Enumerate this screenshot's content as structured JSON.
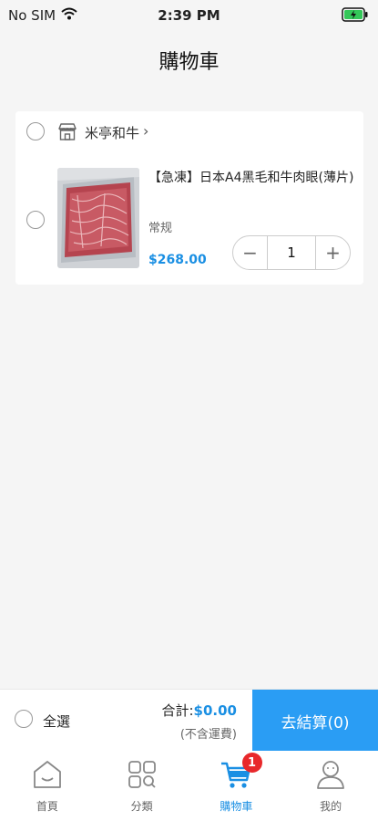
{
  "status_bar": {
    "carrier": "No SIM",
    "time": "2:39 PM"
  },
  "nav": {
    "title": "購物車"
  },
  "shop": {
    "name": "米亭和牛",
    "chevron": "›"
  },
  "item": {
    "title": "【急凍】日本A4黑毛和牛肉眼(薄片)",
    "spec": "常规",
    "price": "$268.00",
    "quantity": "1",
    "minus": "−",
    "plus": "+"
  },
  "checkout": {
    "select_all_label": "全選",
    "total_label": "合計:",
    "total_amount": "$0.00",
    "shipping_note": "(不含運費)",
    "checkout_button_label": "去結算(0)"
  },
  "tabs": [
    {
      "label": "首頁",
      "icon": "home-icon",
      "active": false
    },
    {
      "label": "分類",
      "icon": "category-icon",
      "active": false
    },
    {
      "label": "購物車",
      "icon": "cart-icon",
      "active": true,
      "badge": "1"
    },
    {
      "label": "我的",
      "icon": "profile-icon",
      "active": false
    }
  ],
  "colors": {
    "accent": "#2a9df4",
    "price": "#1a8fe3",
    "badge": "#e8282b"
  }
}
